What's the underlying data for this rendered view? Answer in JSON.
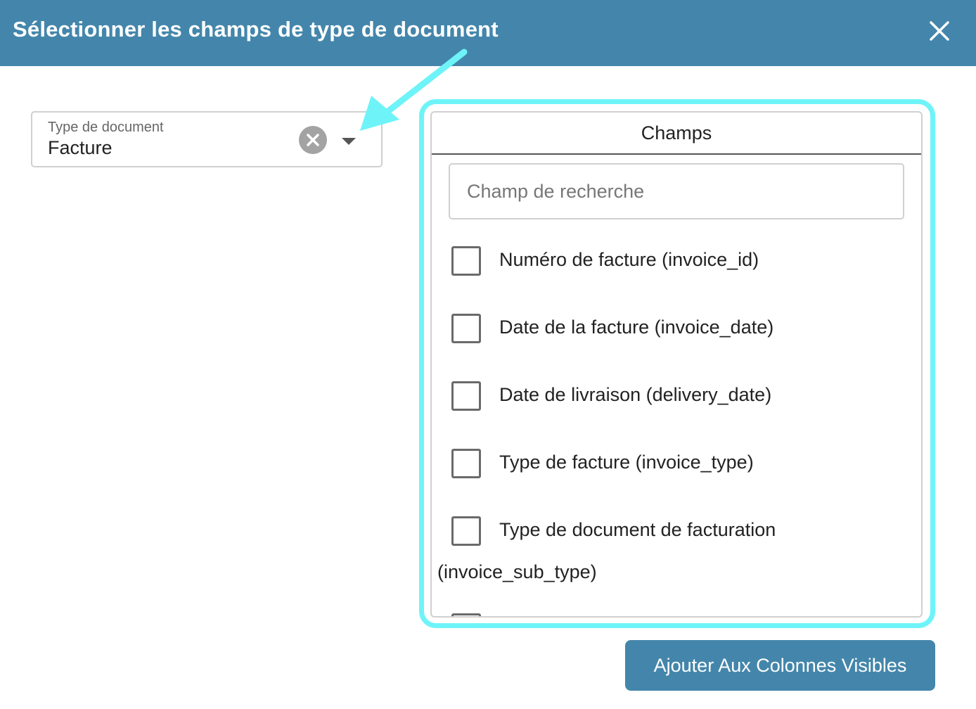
{
  "dialog": {
    "title": "Sélectionner les champs de type de document",
    "close_icon": "close-icon"
  },
  "document_type": {
    "label": "Type de document",
    "value": "Facture",
    "clear_icon": "clear-circle-icon",
    "dropdown_icon": "caret-down-icon"
  },
  "fields_panel": {
    "header": "Champs",
    "search_placeholder": "Champ de recherche",
    "search_value": "",
    "items": [
      {
        "label": "Numéro de facture (invoice_id)",
        "checked": false
      },
      {
        "label": "Date de la facture (invoice_date)",
        "checked": false
      },
      {
        "label": "Date de livraison (delivery_date)",
        "checked": false
      },
      {
        "label": "Type de facture (invoice_type)",
        "checked": false
      },
      {
        "label": "Type de document de facturation",
        "label_continued": "(invoice_sub_type)",
        "checked": false
      }
    ]
  },
  "footer": {
    "add_button_label": "Ajouter Aux Colonnes Visibles"
  },
  "colors": {
    "header_bg": "#4486ab",
    "highlight": "#6ef4f8",
    "button_bg": "#4486ab"
  }
}
